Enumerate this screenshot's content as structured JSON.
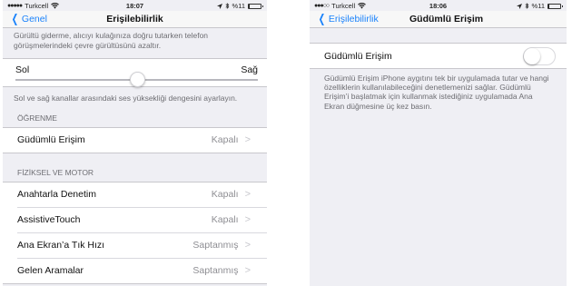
{
  "left_screen": {
    "status": {
      "carrier": "Turkcell",
      "time": "18:07",
      "battery": "%11",
      "battery_level": 0.11
    },
    "nav": {
      "back_label": "Genel",
      "title": "Erişilebilirlik"
    },
    "top_note": "Gürültü giderme, alıcıyı kulağınıza doğru tutarken telefon görüşmelerindeki çevre gürültüsünü azaltır.",
    "balance": {
      "left_label": "Sol",
      "right_label": "Sağ",
      "value": 0.5
    },
    "balance_note": "Sol ve sağ kanallar arasındaki ses yüksekliği dengesini ayarlayın.",
    "learning": {
      "header": "ÖĞRENME",
      "rows": [
        {
          "label": "Güdümlü Erişim",
          "value": "Kapalı"
        }
      ]
    },
    "motor": {
      "header": "FİZİKSEL VE MOTOR",
      "rows": [
        {
          "label": "Anahtarla Denetim",
          "value": "Kapalı"
        },
        {
          "label": "AssistiveTouch",
          "value": "Kapalı"
        },
        {
          "label": "Ana Ekran’a Tık Hızı",
          "value": "Saptanmış"
        },
        {
          "label": "Gelen Aramalar",
          "value": "Saptanmış"
        }
      ]
    }
  },
  "right_screen": {
    "status": {
      "carrier": "Turkcell",
      "time": "18:06",
      "battery": "%11",
      "battery_level": 0.11
    },
    "nav": {
      "back_label": "Erişilebilirlik",
      "title": "Güdümlü Erişim"
    },
    "toggle": {
      "label": "Güdümlü Erişim",
      "on": false
    },
    "description": "Güdümlü Erişim iPhone aygıtını tek bir uygulamada tutar ve hangi özelliklerin kullanılabileceğini denetlemenizi sağlar. Güdümlü Erişim’i başlatmak için kullanmak istediğiniz uygulamada Ana Ekran düğmesine üç kez basın."
  },
  "colors": {
    "accent": "#1a82fb",
    "background": "#efeff4"
  },
  "icons": {
    "back": "chevron-left-icon",
    "disclosure": "chevron-right-icon",
    "wifi": "wifi-icon",
    "location": "location-arrow-icon",
    "bluetooth": "bluetooth-icon"
  }
}
